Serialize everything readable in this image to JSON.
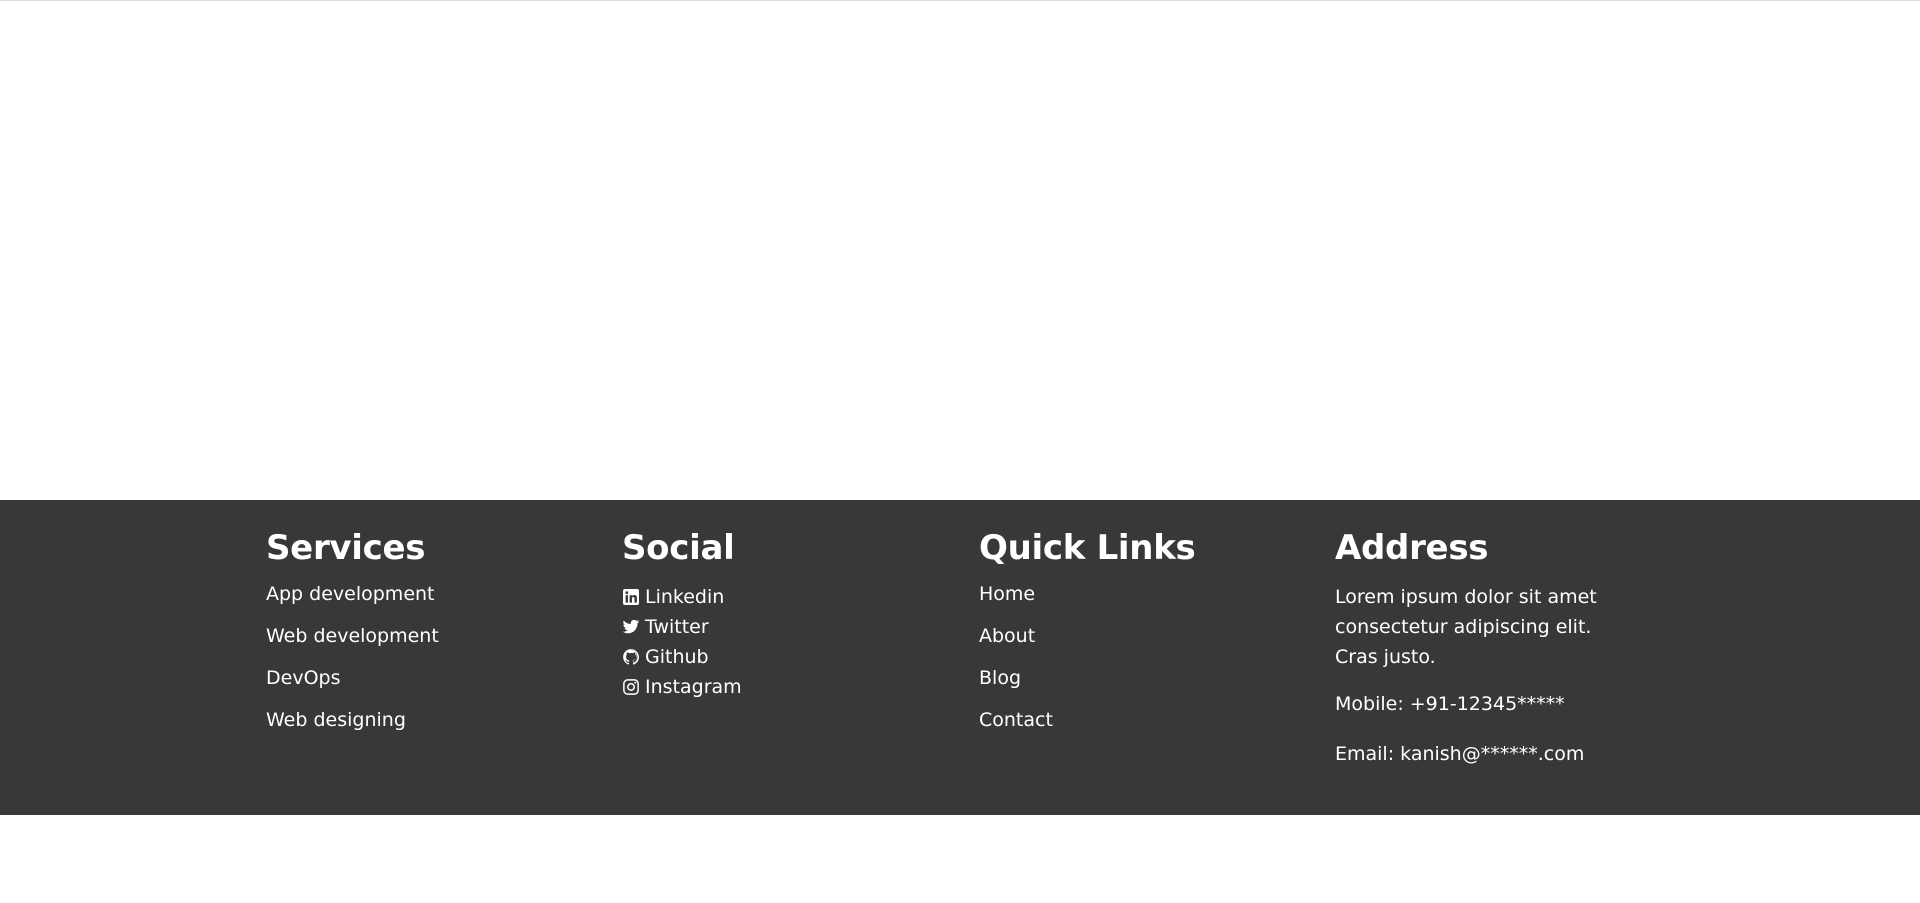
{
  "footer": {
    "services": {
      "title": "Services",
      "items": [
        "App development",
        "Web development",
        "DevOps",
        "Web designing"
      ]
    },
    "social": {
      "title": "Social",
      "items": [
        {
          "label": "Linkedin",
          "icon": "linkedin-icon"
        },
        {
          "label": "Twitter",
          "icon": "twitter-icon"
        },
        {
          "label": "Github",
          "icon": "github-icon"
        },
        {
          "label": "Instagram",
          "icon": "instagram-icon"
        }
      ]
    },
    "quick_links": {
      "title": "Quick Links",
      "items": [
        "Home",
        "About",
        "Blog",
        "Contact"
      ]
    },
    "address": {
      "title": "Address",
      "text": "Lorem ipsum dolor sit amet consectetur adipiscing elit. Cras justo.",
      "mobile": "Mobile: +91-12345*****",
      "email": "Email: kanish@******.com"
    }
  },
  "colors": {
    "footer_bg": "#383838",
    "text": "#ffffff"
  }
}
